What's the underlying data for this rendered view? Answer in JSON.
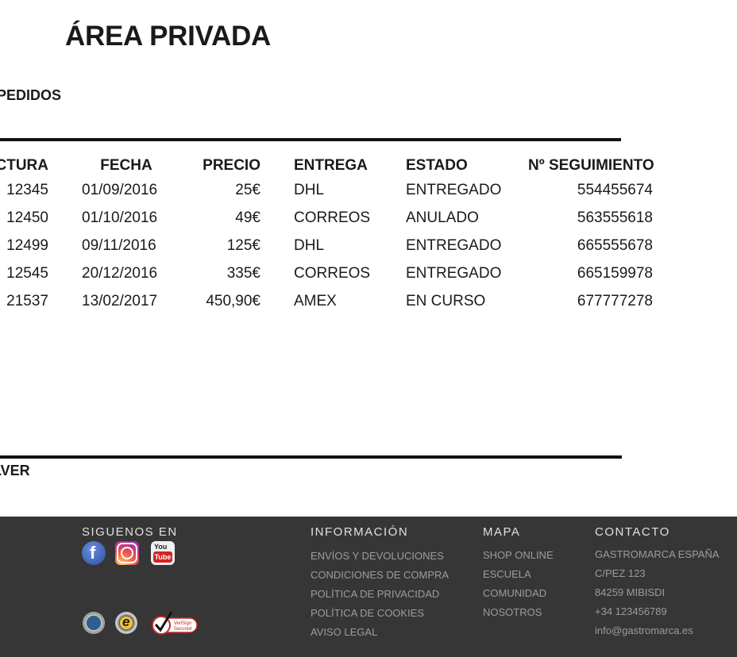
{
  "page": {
    "title": "ÁREA PRIVADA",
    "section_label": "PEDIDOS",
    "back_label": "LVER"
  },
  "orders": {
    "headers": [
      "CTURA",
      "FECHA",
      "PRECIO",
      "ENTREGA",
      "ESTADO",
      "Nº SEGUIMIENTO"
    ],
    "rows": [
      [
        "12345",
        "01/09/2016",
        "25€",
        "DHL",
        "ENTREGADO",
        "554455674"
      ],
      [
        "12450",
        "01/10/2016",
        "49€",
        "CORREOS",
        "ANULADO",
        "563555618"
      ],
      [
        "12499",
        "09/11/2016",
        "125€",
        "DHL",
        "ENTREGADO",
        "665555678"
      ],
      [
        "12545",
        "20/12/2016",
        "335€",
        "CORREOS",
        "ENTREGADO",
        "665159978"
      ],
      [
        "21537",
        "13/02/2017",
        "450,90€",
        "AMEX",
        "EN CURSO",
        "677777278"
      ]
    ]
  },
  "footer": {
    "social_heading": "SIGUENOS EN",
    "social_icons": [
      "facebook-icon",
      "instagram-icon",
      "youtube-icon"
    ],
    "trust_badges": [
      "secure-seal-icon",
      "ecommerce-trust-seal-icon",
      "verisign-secured-icon"
    ],
    "verisign_text": [
      "VeriSign",
      "Secured"
    ],
    "info_heading": "INFORMACIÓN",
    "info_links": [
      "ENVÍOS Y DEVOLUCIONES",
      "CONDICIONES DE COMPRA",
      "POLÍTICA DE PRIVACIDAD",
      "POLÍTICA DE COOKIES",
      "AVISO LEGAL"
    ],
    "map_heading": "MAPA",
    "map_links": [
      "SHOP ONLINE",
      "ESCUELA",
      "COMUNIDAD",
      "NOSOTROS"
    ],
    "contact_heading": "CONTACTO",
    "contact_lines": [
      "GASTROMARCA ESPAÑA",
      "C/PEZ 123",
      "84259 MIBISDI",
      "+34 123456789",
      "info@gastromarca.es"
    ]
  },
  "colors": {
    "footer_bg": "#363636",
    "text": "#1a1a1a",
    "footer_link": "#9c9c9c",
    "rule": "#111111"
  }
}
